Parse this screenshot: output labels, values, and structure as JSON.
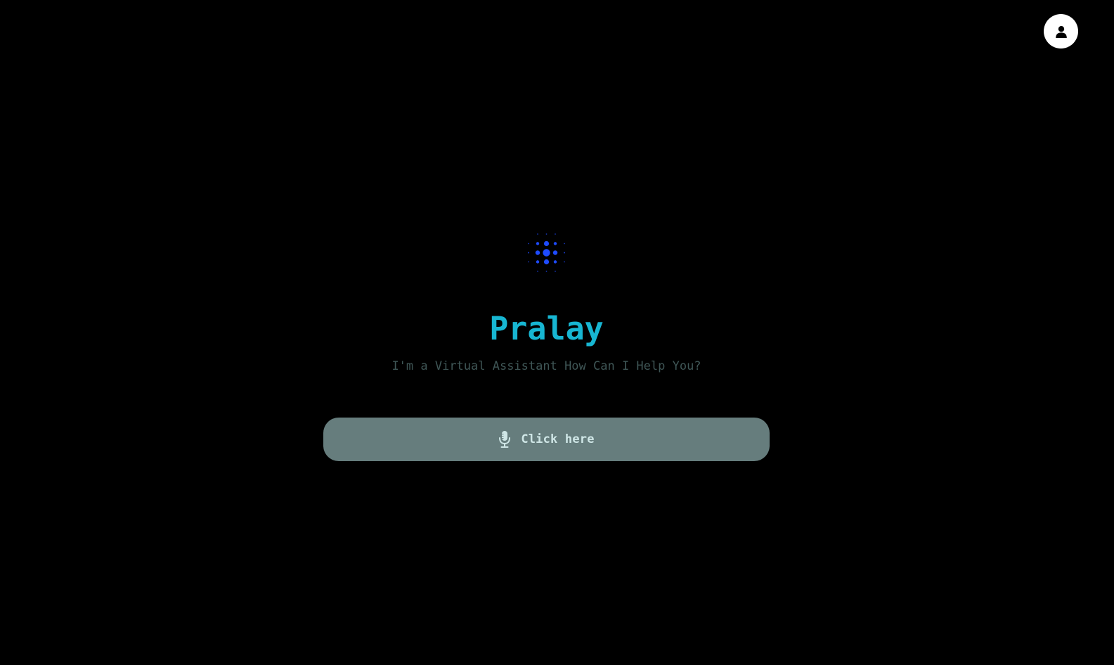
{
  "header": {
    "profile_icon": "user-icon",
    "profile_button_color": "#ffffff"
  },
  "hero": {
    "logo_icon": "dot-matrix-orb-icon",
    "logo_color": "#1e4bff",
    "title": "Pralay",
    "title_color": "#17b6d2",
    "subtitle": "I'm a Virtual Assistant How Can I Help You?",
    "subtitle_color": "#3f5656"
  },
  "action": {
    "button_label": "Click here",
    "button_icon": "microphone-icon",
    "button_color": "#667d7d",
    "label_color": "#cfe6e6"
  },
  "theme": {
    "background": "#000000"
  }
}
